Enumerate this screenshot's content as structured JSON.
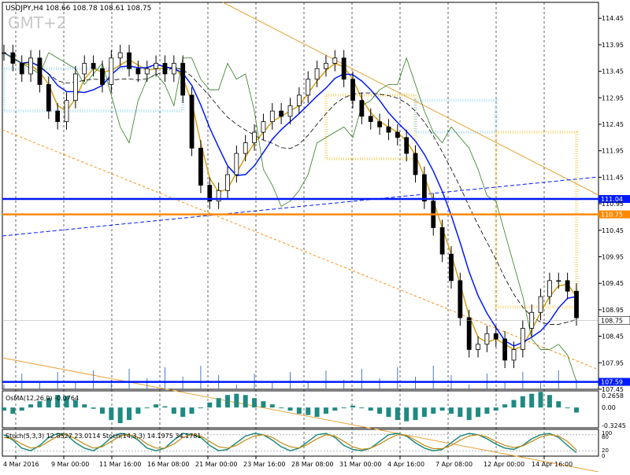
{
  "header": {
    "symbol_line": "USDJPY,H4  108.66 108.78 108.61 108.75",
    "timezone_label": "GMT+2"
  },
  "chart_data": {
    "type": "candlestick",
    "symbol": "USDJPY",
    "timeframe": "H4",
    "ohlc_last": {
      "open": 108.66,
      "high": 108.78,
      "low": 108.61,
      "close": 108.75
    },
    "ylim": [
      107.45,
      114.75
    ],
    "y_ticks": [
      114.45,
      113.95,
      113.45,
      112.95,
      112.45,
      111.95,
      111.45,
      110.95,
      110.45,
      109.95,
      109.45,
      108.95,
      108.45,
      107.95,
      107.45
    ],
    "x_ticks": [
      "4 Mar 2016",
      "9 Mar 00:00",
      "11 Mar 16:00",
      "16 Mar 08:00",
      "21 Mar 00:00",
      "23 Mar 16:00",
      "28 Mar 08:00",
      "31 Mar 00:00",
      "4 Apr 16:00",
      "7 Apr 08:00",
      "12 Apr 00:00",
      "14 Apr 16:00"
    ],
    "close_path": [
      113.8,
      113.6,
      113.4,
      113.7,
      113.2,
      112.7,
      112.5,
      112.9,
      113.4,
      113.6,
      113.5,
      113.2,
      113.7,
      113.8,
      113.5,
      113.4,
      113.5,
      113.6,
      113.4,
      113.6,
      113.0,
      112.0,
      111.3,
      111.0,
      111.2,
      111.5,
      111.9,
      112.1,
      112.3,
      112.5,
      112.7,
      112.6,
      112.8,
      113.0,
      113.3,
      113.5,
      113.6,
      113.7,
      113.3,
      112.9,
      112.6,
      112.5,
      112.4,
      112.3,
      112.2,
      111.9,
      111.5,
      111.0,
      110.5,
      110.0,
      109.5,
      108.8,
      108.2,
      108.3,
      108.5,
      108.4,
      108.0,
      108.2,
      108.6,
      108.9,
      109.2,
      109.5,
      109.5,
      109.3,
      108.8
    ],
    "horizontal_levels": [
      {
        "label": "111.04",
        "value": 111.04,
        "color": "#0019ff"
      },
      {
        "label": "110.75",
        "value": 110.75,
        "color": "#ff8800"
      },
      {
        "label": "107.59",
        "value": 107.59,
        "color": "#0019ff"
      }
    ],
    "current_price_label": "108.75",
    "osma": {
      "label": "OsMA(12,26,9) -0.0764",
      "ylim": [
        -0.3245,
        0.2658
      ],
      "y_ticks": [
        "0.2658",
        "0.00",
        "-0.3245"
      ],
      "values": [
        -0.05,
        -0.1,
        -0.05,
        0.05,
        0.1,
        0.15,
        0.2,
        0.18,
        0.12,
        0.05,
        -0.02,
        -0.1,
        -0.2,
        -0.25,
        -0.2,
        -0.1,
        0.0,
        0.05,
        0.02,
        -0.1,
        -0.15,
        -0.1,
        0.0,
        0.08,
        0.15,
        0.2,
        0.22,
        0.2,
        0.15,
        0.1,
        0.05,
        0.0,
        -0.05,
        -0.1,
        -0.12,
        -0.15,
        -0.1,
        -0.05,
        0.0,
        0.03,
        0.0,
        -0.05,
        -0.1,
        -0.15,
        -0.2,
        -0.22,
        -0.2,
        -0.15,
        -0.1,
        -0.05,
        -0.1,
        -0.15,
        -0.2,
        -0.15,
        -0.1,
        -0.05,
        0.05,
        0.12,
        0.18,
        0.22,
        0.25,
        0.2,
        0.1,
        0.0,
        -0.08
      ]
    },
    "stoch": {
      "label": "Stoch(5,3,3) 12.8527 23.0114   Stoch(14,3,3) 14.1975 34.1781",
      "y_ticks": [
        "100",
        "80",
        "20",
        "0"
      ],
      "k_values": [
        80,
        60,
        30,
        20,
        40,
        70,
        85,
        80,
        50,
        30,
        20,
        40,
        70,
        85,
        80,
        60,
        30,
        20,
        30,
        60,
        85,
        80,
        70,
        40,
        20,
        25,
        50,
        75,
        85,
        80,
        60,
        35,
        20,
        30,
        55,
        80,
        85,
        70,
        40,
        25,
        20,
        30,
        55,
        80,
        85,
        75,
        50,
        30,
        20,
        25,
        50,
        75,
        85,
        80,
        65,
        45,
        30,
        25,
        40,
        65,
        80,
        85,
        70,
        40,
        13
      ],
      "d_values": [
        70,
        65,
        45,
        30,
        35,
        55,
        75,
        80,
        65,
        45,
        30,
        35,
        55,
        75,
        80,
        70,
        45,
        30,
        30,
        45,
        70,
        80,
        75,
        55,
        35,
        30,
        40,
        60,
        75,
        80,
        70,
        50,
        35,
        30,
        45,
        65,
        80,
        75,
        55,
        35,
        25,
        30,
        45,
        65,
        80,
        78,
        60,
        40,
        28,
        28,
        40,
        60,
        75,
        80,
        72,
        55,
        40,
        32,
        38,
        55,
        72,
        80,
        75,
        55,
        23
      ]
    },
    "grid": true
  }
}
